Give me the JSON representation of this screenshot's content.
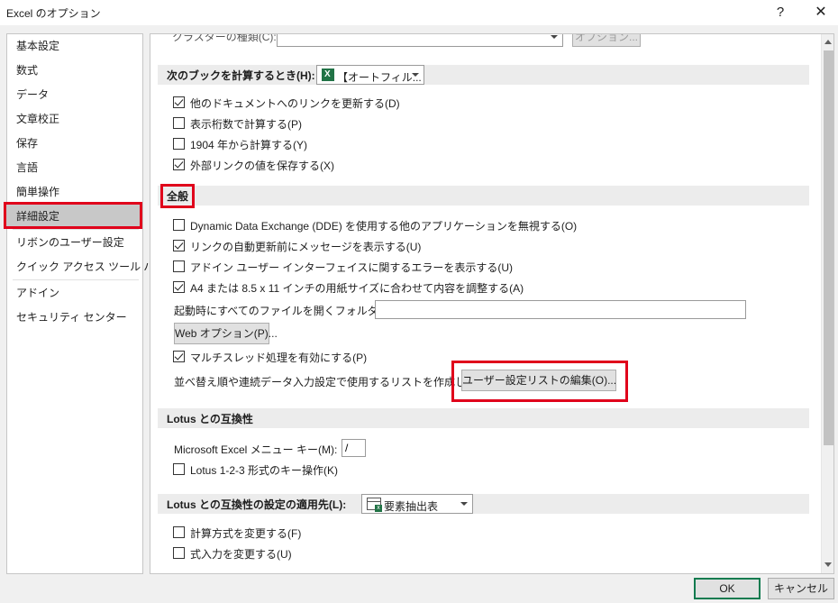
{
  "window": {
    "title": "Excel のオプション",
    "help": "?",
    "close": "✕"
  },
  "sidebar": {
    "items": [
      {
        "label": "基本設定"
      },
      {
        "label": "数式"
      },
      {
        "label": "データ"
      },
      {
        "label": "文章校正"
      },
      {
        "label": "保存"
      },
      {
        "label": "言語"
      },
      {
        "label": "簡単操作"
      },
      {
        "label": "詳細設定",
        "selected": true
      },
      {
        "label": "リボンのユーザー設定"
      },
      {
        "label": "クイック アクセス ツール バー"
      },
      {
        "label": "アドイン"
      },
      {
        "label": "セキュリティ センター"
      }
    ]
  },
  "content": {
    "cluster_type_label": "クラスターの種類(C):",
    "cluster_options_button": "オプション...",
    "calc_section": {
      "title": "次のブックを計算するとき(H):",
      "workbook_dropdown_value": "【オートフィル...",
      "options": [
        {
          "label": "他のドキュメントへのリンクを更新する(D)",
          "checked": true
        },
        {
          "label": "表示桁数で計算する(P)",
          "checked": false
        },
        {
          "label": "1904 年から計算する(Y)",
          "checked": false
        },
        {
          "label": "外部リンクの値を保存する(X)",
          "checked": true
        }
      ]
    },
    "general_section": {
      "title": "全般",
      "options": [
        {
          "label": "Dynamic Data Exchange (DDE) を使用する他のアプリケーションを無視する(O)",
          "checked": false
        },
        {
          "label": "リンクの自動更新前にメッセージを表示する(U)",
          "checked": true
        },
        {
          "label": "アドイン ユーザー インターフェイスに関するエラーを表示する(U)",
          "checked": false
        },
        {
          "label": "A4 または 8.5 x 11 インチの用紙サイズに合わせて内容を調整する(A)",
          "checked": true
        }
      ],
      "startup_folder_label": "起動時にすべてのファイルを開くフォルダー(L):",
      "startup_folder_value": "",
      "web_options_button": "Web オプション(P)...",
      "multithread_option": {
        "label": "マルチスレッド処理を有効にする(P)",
        "checked": true
      },
      "custom_list_label": "並べ替え順や連続データ入力設定で使用するリストを作成します:",
      "custom_list_button": "ユーザー設定リストの編集(O)..."
    },
    "lotus_section": {
      "title": "Lotus との互換性",
      "menu_key_label": "Microsoft Excel メニュー キー(M):",
      "menu_key_value": "/",
      "options": [
        {
          "label": "Lotus 1-2-3 形式のキー操作(K)",
          "checked": false
        }
      ]
    },
    "lotus_settings_section": {
      "title": "Lotus との互換性の設定の適用先(L):",
      "sheet_dropdown_value": "要素抽出表",
      "options": [
        {
          "label": "計算方式を変更する(F)",
          "checked": false
        },
        {
          "label": "式入力を変更する(U)",
          "checked": false
        }
      ]
    }
  },
  "footer": {
    "ok_label": "OK",
    "cancel_label": "キャンセル"
  },
  "colors": {
    "highlight": "#e0001b",
    "selected_nav": "#c8c8c8",
    "excel_green": "#217346"
  }
}
